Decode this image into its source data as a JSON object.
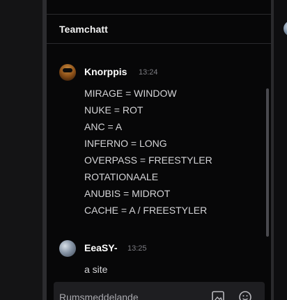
{
  "panel": {
    "title": "Teamchatt"
  },
  "messages": [
    {
      "author": "Knorppis",
      "time": "13:24",
      "lines": [
        "MIRAGE = WINDOW",
        "NUKE = ROT",
        "ANC = A",
        "INFERNO = LONG",
        "OVERPASS = FREESTYLER",
        "ROTATIONAALE",
        "ANUBIS = MIDROT",
        "CACHE = A / FREESTYLER"
      ]
    },
    {
      "author": "EeaSY-",
      "time": "13:25",
      "lines": [
        "a site"
      ]
    }
  ],
  "composer": {
    "placeholder": "Rumsmeddelande",
    "icons": [
      "image-icon",
      "emoji-icon"
    ]
  },
  "colors": {
    "panel_bg": "#070708",
    "text": "#d5d5d8",
    "author": "#ffffff",
    "timestamp": "#7d7d83",
    "composer_bg": "#1e1e21"
  }
}
